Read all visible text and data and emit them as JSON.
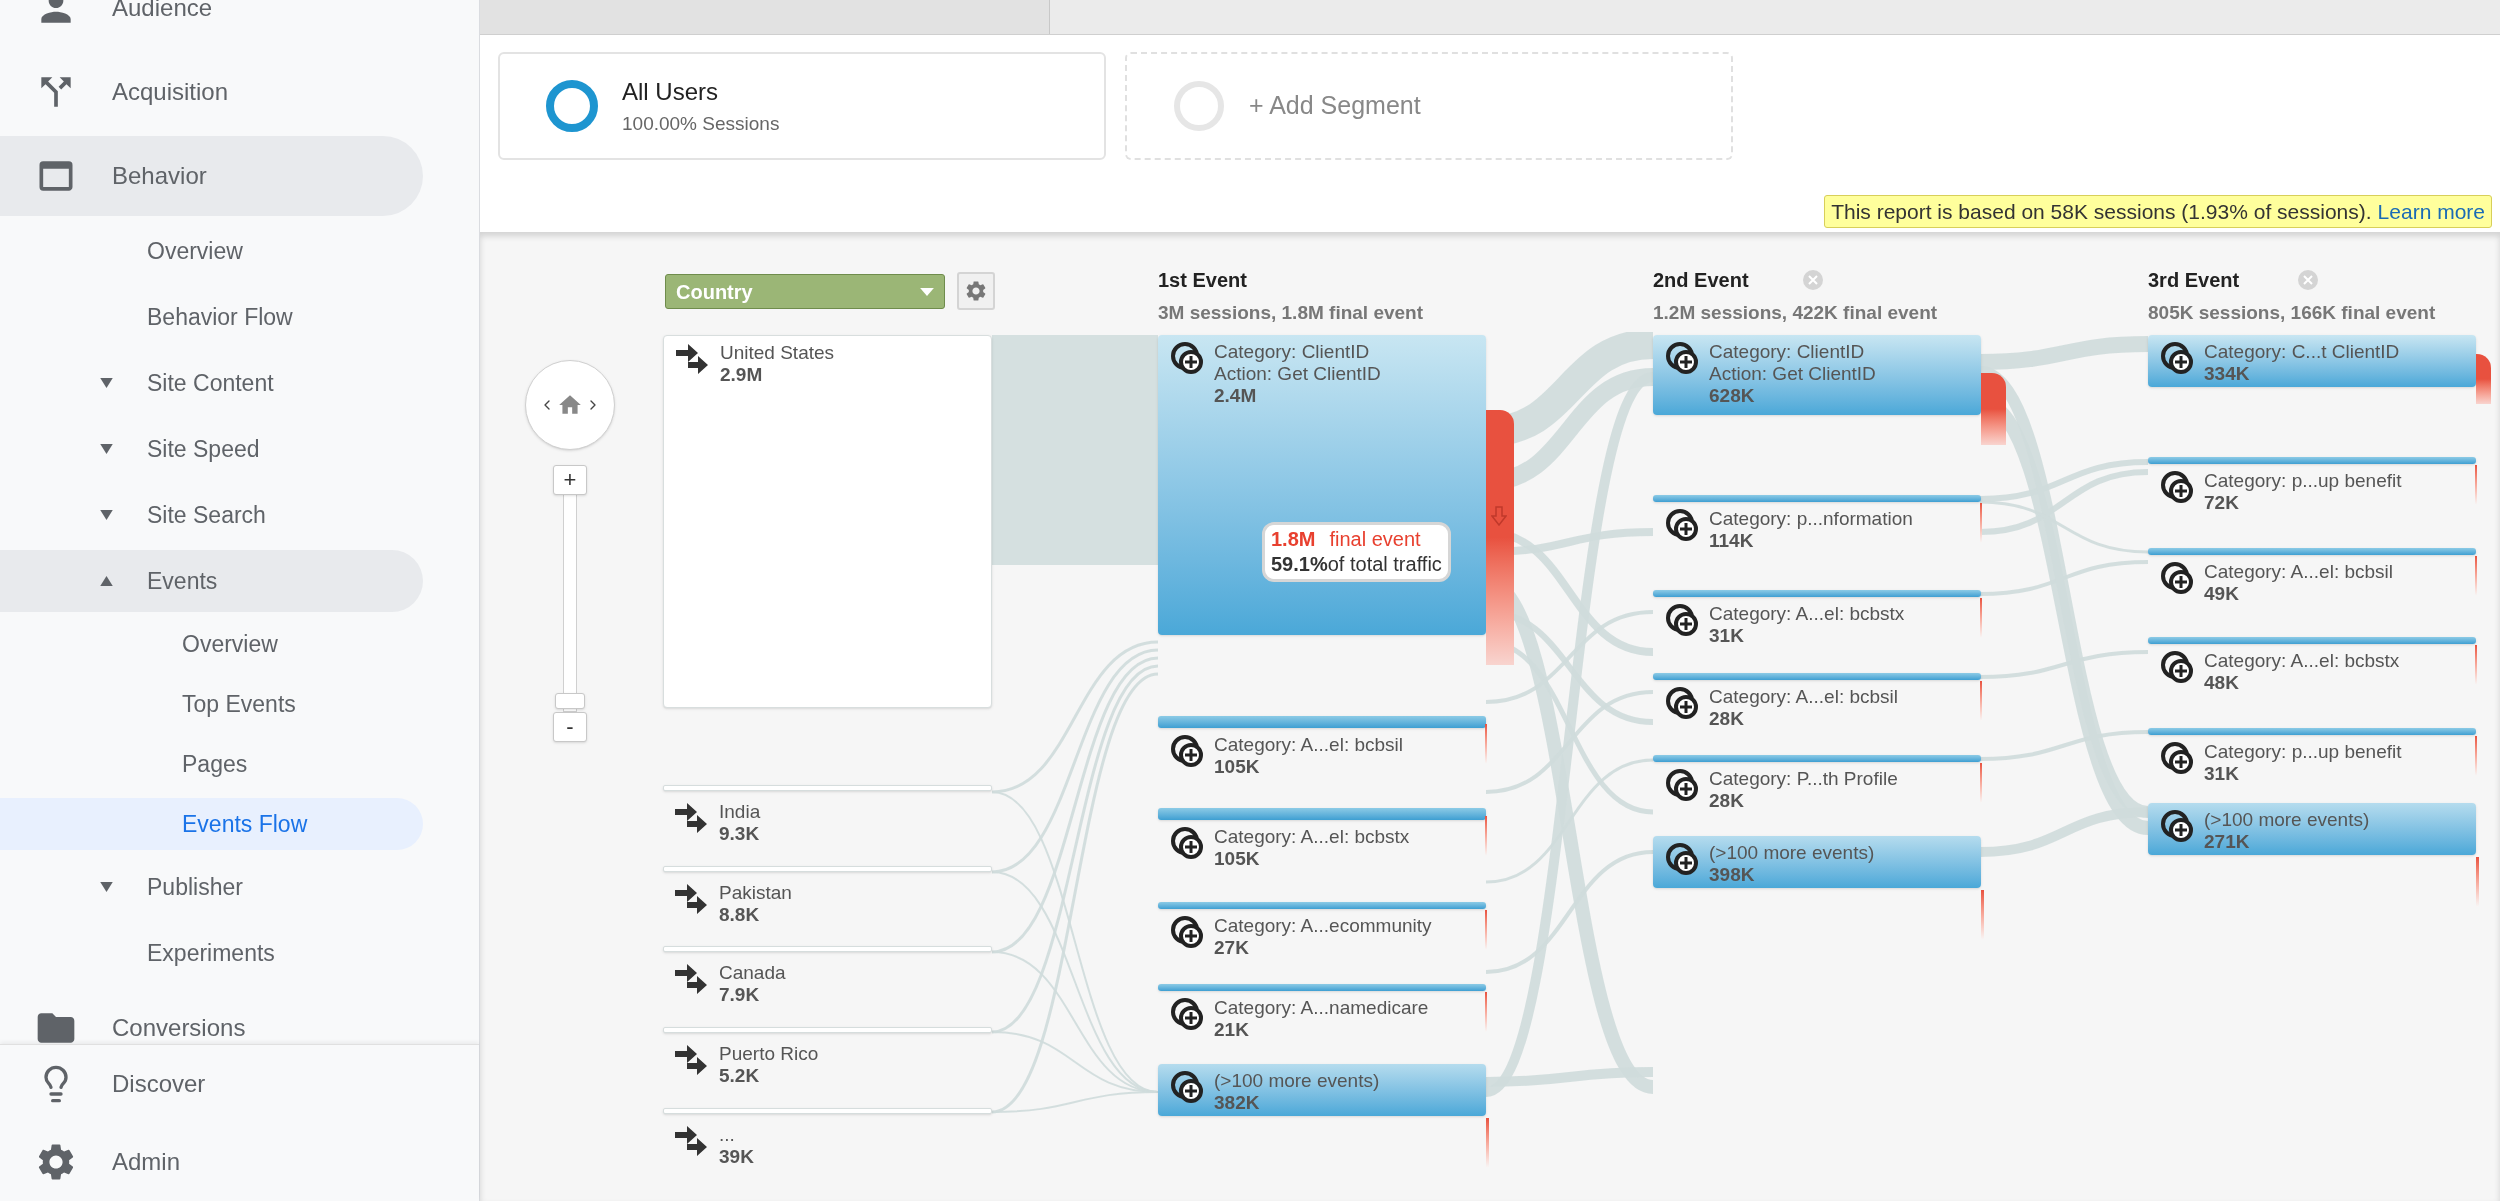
{
  "sidebar": {
    "items": [
      {
        "label": "Audience",
        "selected": false
      },
      {
        "label": "Acquisition",
        "selected": false
      },
      {
        "label": "Behavior",
        "selected": false,
        "expanded": true,
        "children": [
          {
            "label": "Overview",
            "selected": false
          },
          {
            "label": "Behavior Flow",
            "selected": false
          },
          {
            "label": "Site Content",
            "selected": false,
            "expanded": false
          },
          {
            "label": "Site Speed",
            "selected": false,
            "expanded": false
          },
          {
            "label": "Site Search",
            "selected": false,
            "expanded": false
          },
          {
            "label": "Events",
            "selected": false,
            "expanded": true,
            "children": [
              {
                "label": "Overview",
                "selected": false
              },
              {
                "label": "Top Events",
                "selected": false
              },
              {
                "label": "Pages",
                "selected": false
              },
              {
                "label": "Events Flow",
                "selected": true
              }
            ]
          },
          {
            "label": "Publisher",
            "selected": false,
            "expanded": false
          },
          {
            "label": "Experiments",
            "selected": false
          }
        ]
      },
      {
        "label": "Conversions",
        "selected": false
      }
    ],
    "footer_items": [
      {
        "label": "Discover"
      },
      {
        "label": "Admin"
      }
    ]
  },
  "segments": [
    {
      "kind": "segment",
      "name": "All Users",
      "subtitle": "100.00% Sessions"
    },
    {
      "kind": "add",
      "name": "+ Add Segment"
    }
  ],
  "notice": {
    "text": "This report is based on 58K sessions (1.93% of sessions).",
    "link": "Learn more"
  },
  "flow": {
    "dimension": "Country",
    "zoom": {
      "plus": "+",
      "minus": "-",
      "level": 0
    },
    "starting_nodes": [
      {
        "kind": "block",
        "label": "United States",
        "value": "2.9M"
      },
      {
        "kind": "line",
        "label": "India",
        "value": "9.3K"
      },
      {
        "kind": "line",
        "label": "Pakistan",
        "value": "8.8K"
      },
      {
        "kind": "line",
        "label": "Canada",
        "value": "7.9K"
      },
      {
        "kind": "line",
        "label": "Puerto Rico",
        "value": "5.2K"
      },
      {
        "kind": "line",
        "label": "...",
        "value": "39K"
      }
    ],
    "steps": [
      {
        "title": "1st Event",
        "summary": "3M sessions, 1.8M final event",
        "closable": false,
        "nodes": [
          {
            "kind": "block",
            "label": "Category: ClientID",
            "action": "Action: Get ClientID",
            "value": "2.4M"
          },
          {
            "kind": "line",
            "label": "Category: A...el: bcbsil",
            "value": "105K"
          },
          {
            "kind": "line",
            "label": "Category: A...el: bcbstx",
            "value": "105K"
          },
          {
            "kind": "line",
            "label": "Category: A...ecommunity",
            "value": "27K"
          },
          {
            "kind": "line",
            "label": "Category: A...namedicare",
            "value": "21K"
          },
          {
            "kind": "block",
            "label": "(>100 more events)",
            "value": "382K"
          }
        ],
        "tooltip": {
          "value": "1.8M",
          "label": "final event",
          "percent": "59.1%",
          "percent_label": "of total traffic"
        }
      },
      {
        "title": "2nd Event",
        "summary": "1.2M sessions, 422K final event",
        "closable": true,
        "nodes": [
          {
            "kind": "block",
            "label": "Category: ClientID",
            "action": "Action: Get ClientID",
            "value": "628K"
          },
          {
            "kind": "line",
            "label": "Category: p...nformation",
            "value": "114K"
          },
          {
            "kind": "line",
            "label": "Category: A...el: bcbstx",
            "value": "31K"
          },
          {
            "kind": "line",
            "label": "Category: A...el: bcbsil",
            "value": "28K"
          },
          {
            "kind": "line",
            "label": "Category: P...th Profile",
            "value": "28K"
          },
          {
            "kind": "block",
            "label": "(>100 more events)",
            "value": "398K"
          }
        ]
      },
      {
        "title": "3rd Event",
        "summary": "805K sessions, 166K final event",
        "closable": true,
        "nodes": [
          {
            "kind": "block",
            "label": "Category: C...t ClientID",
            "value": "334K"
          },
          {
            "kind": "line",
            "label": "Category: p...up benefit",
            "value": "72K"
          },
          {
            "kind": "line",
            "label": "Category: A...el: bcbsil",
            "value": "49K"
          },
          {
            "kind": "line",
            "label": "Category: A...el: bcbstx",
            "value": "48K"
          },
          {
            "kind": "line",
            "label": "Category: p...up benefit",
            "value": "31K"
          },
          {
            "kind": "block",
            "label": "(>100 more events)",
            "value": "271K"
          }
        ]
      }
    ]
  }
}
